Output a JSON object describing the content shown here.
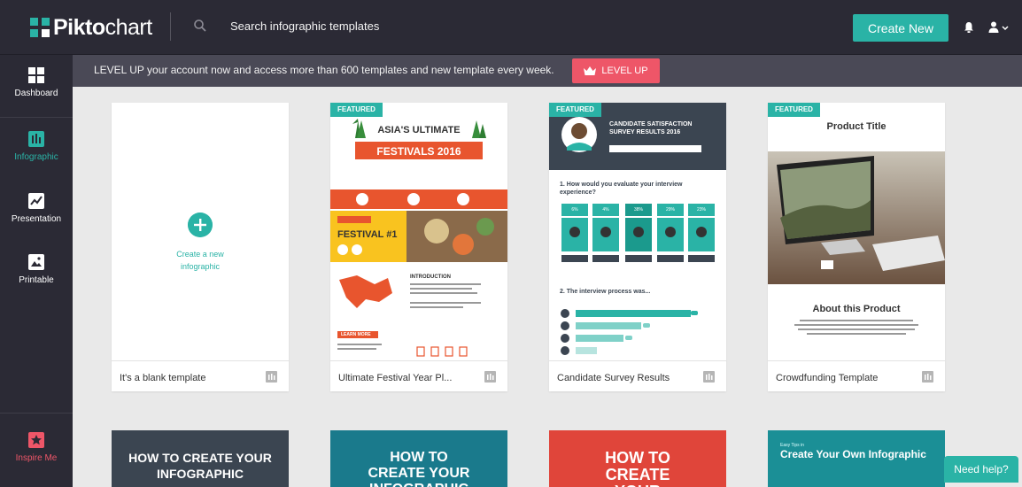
{
  "app": {
    "logo_bold": "Pikto",
    "logo_light": "chart",
    "search_placeholder": "Search infographic templates",
    "create_label": "Create New"
  },
  "sidebar": {
    "items": [
      {
        "label": "Dashboard",
        "icon": "grid-icon"
      },
      {
        "label": "Infographic",
        "icon": "bar-chart-icon",
        "active": true
      },
      {
        "label": "Presentation",
        "icon": "line-chart-icon"
      },
      {
        "label": "Printable",
        "icon": "image-icon"
      }
    ],
    "inspire_label": "Inspire Me"
  },
  "banner": {
    "text": "LEVEL UP your account now and access more than 600 templates and new template every week.",
    "button_label": "LEVEL UP"
  },
  "templates": [
    {
      "name": "It's a blank template",
      "featured": false,
      "create_text": "Create a new infographic"
    },
    {
      "name": "Ultimate Festival Year Pl...",
      "featured": true,
      "preview": {
        "headline": "ASIA'S ULTIMATE",
        "banner": "FESTIVALS 2016",
        "festival_label": "FESTIVAL #1",
        "section_title": "INTRODUCTION",
        "button": "LEARN MORE"
      }
    },
    {
      "name": "Candidate Survey Results",
      "featured": true,
      "preview": {
        "title": "CANDIDATE SATISFACTION SURVEY RESULTS 2016",
        "q1": "1. How would you evaluate your interview experience?",
        "percents": [
          "6%",
          "4%",
          "38%",
          "29%",
          "23%"
        ],
        "q2": "2. The interview process was..."
      }
    },
    {
      "name": "Crowdfunding Template",
      "featured": true,
      "preview": {
        "title": "Product Title",
        "subtitle": "About this Product"
      }
    }
  ],
  "featured_label": "FEATURED",
  "bottom_cards": [
    {
      "title": "HOW TO CREATE YOUR INFOGRAPHIC",
      "color": "#3b4551"
    },
    {
      "title": "HOW TO CREATE YOUR INFOGRAPHIC",
      "color": "#1a7a8c"
    },
    {
      "title": "HOW TO CREATE YOUR",
      "color": "#e0453a"
    },
    {
      "title": "Create Your Own Infographic",
      "small": "Easy Tips in",
      "color": "#1b8f96"
    }
  ],
  "help_label": "Need help?",
  "colors": {
    "accent": "#2ab3a6",
    "dark": "#2b2a35",
    "pink": "#ee5668"
  }
}
